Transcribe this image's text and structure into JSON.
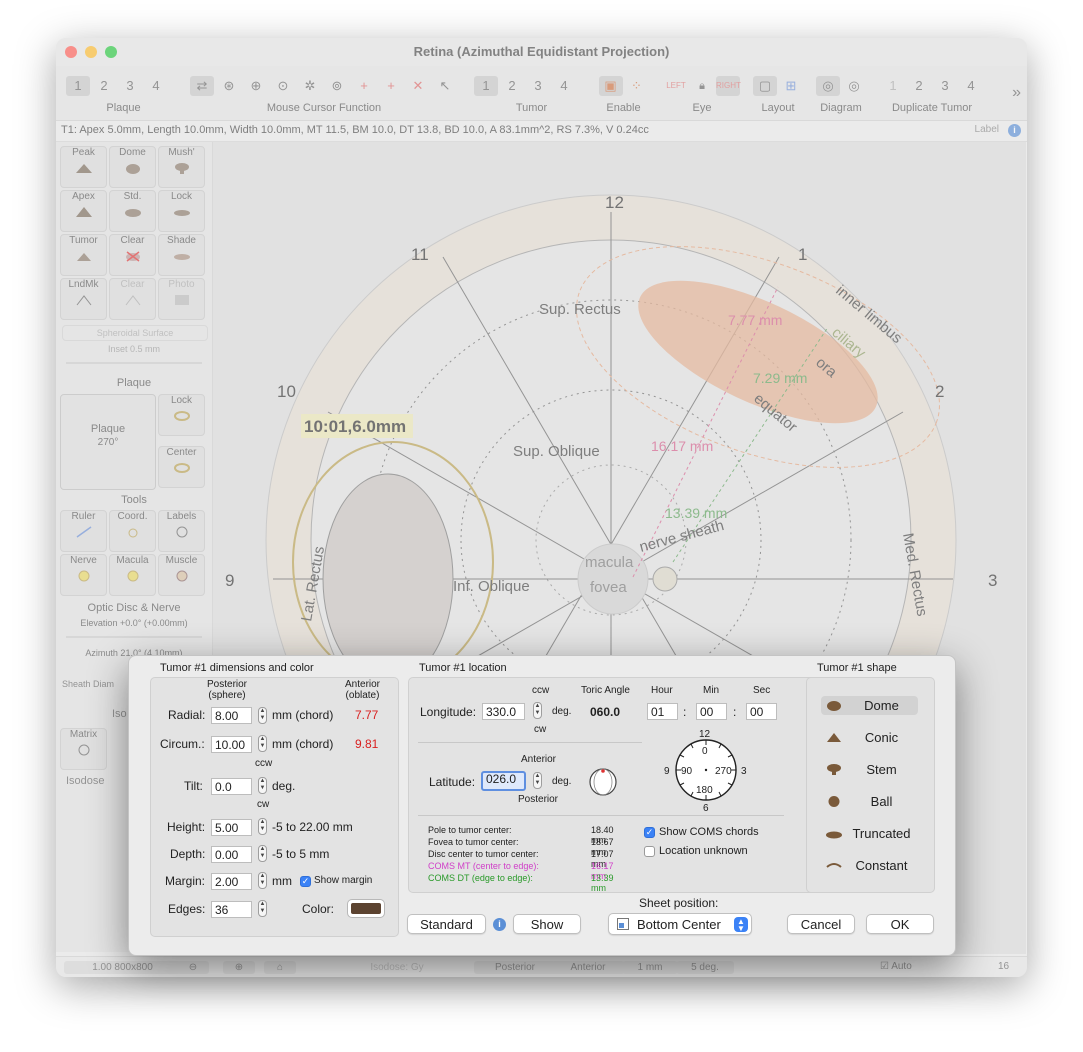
{
  "window": {
    "title": "Retina (Azimuthal Equidistant Projection)",
    "info_text": "T1: Apex 5.0mm, Length 10.0mm, Width 10.0mm, MT 11.5, BM 10.0, DT 13.8, BD 10.0, A 83.1mm^2, RS 7.3%, V 0.24cc",
    "label_toggle": "Label"
  },
  "toolbar": {
    "plaque": {
      "label": "Plaque",
      "buttons": [
        "1",
        "2",
        "3",
        "4"
      ]
    },
    "mouse": {
      "label": "Mouse Cursor Function"
    },
    "tumor": {
      "label": "Tumor",
      "buttons": [
        "1",
        "2",
        "3",
        "4"
      ]
    },
    "enable": {
      "label": "Enable"
    },
    "eye": {
      "label": "Eye",
      "left": "LEFT",
      "right": "RIGHT"
    },
    "layout": {
      "label": "Layout"
    },
    "diagram": {
      "label": "Diagram"
    },
    "duplicate": {
      "label": "Duplicate Tumor",
      "buttons": [
        "1",
        "2",
        "3",
        "4"
      ]
    },
    "more": "»"
  },
  "sidebar": {
    "tiles": [
      "Peak",
      "Dome",
      "Mush'",
      "Apex",
      "Std.",
      "Lock",
      "Tumor",
      "Clear",
      "Shade",
      "LndMk",
      "Clear",
      "Photo",
      "Lock",
      "Center",
      "Ruler",
      "Coord.",
      "Labels",
      "Nerve",
      "Macula",
      "Muscle",
      "Matrix"
    ],
    "spheroidal": "Spheroidal Surface",
    "inset": "Inset 0.5 mm",
    "plaque_heading": "Plaque",
    "plaque_text": "Plaque",
    "plaque_angle": "270°",
    "tools_heading": "Tools",
    "optic_heading": "Optic Disc & Nerve",
    "elevation": "Elevation +0.0° (+0.00mm)",
    "azimuth": "Azimuth 21.0° (4.10mm)",
    "sheath": "Sheath Diam",
    "iso": "Iso",
    "isodose": "Isodose"
  },
  "diagram": {
    "clock": [
      "12",
      "1",
      "2",
      "3",
      "9",
      "10",
      "11"
    ],
    "labels": {
      "sup_rectus": "Sup. Rectus",
      "sup_oblique": "Sup. Oblique",
      "inf_oblique": "Inf. Oblique",
      "lat_rectus": "Lat. Rectus",
      "med_rectus": "Med. Rectus",
      "inner_limbus": "inner limbus",
      "ciliary": "ciliary",
      "ora": "ora",
      "equator": "equator",
      "macula": "macula",
      "fovea": "fovea",
      "nerve_sheath": "nerve sheath"
    },
    "measurements": [
      "7.77 mm",
      "7.29 mm",
      "16.17 mm",
      "13.39 mm"
    ],
    "cursor_readout": "10:01,6.0mm",
    "colors": {
      "tumor": "#e2a07a",
      "coms_mt": "#d45c8a",
      "coms_dt": "#5aa05a",
      "plaque": "#b8a050"
    }
  },
  "statusbar": {
    "scale": "1.00 800x800",
    "isodose": "Isodose: Gy",
    "posterior": "Posterior",
    "anterior": "Anterior",
    "mm": "1 mm",
    "deg": "5 deg.",
    "auto": "Auto",
    "page": "16"
  },
  "sheet": {
    "dims": {
      "title": "Tumor #1 dimensions and color",
      "col_post": "Posterior\n(sphere)",
      "col_ant": "Anterior\n(oblate)",
      "radial_label": "Radial:",
      "radial_value": "8.00",
      "radial_unit": "mm (chord)",
      "radial_ant": "7.77",
      "circum_label": "Circum.:",
      "circum_value": "10.00",
      "circum_unit": "mm (chord)",
      "circum_ant": "9.81",
      "ccw": "ccw",
      "tilt_label": "Tilt:",
      "tilt_value": "0.0",
      "tilt_unit": "deg.",
      "cw": "cw",
      "height_label": "Height:",
      "height_value": "5.00",
      "height_range": "-5 to 22.00 mm",
      "depth_label": "Depth:",
      "depth_value": "0.00",
      "depth_range": "-5 to 5 mm",
      "margin_label": "Margin:",
      "margin_value": "2.00",
      "margin_unit": "mm",
      "show_margin": "Show margin",
      "edges_label": "Edges:",
      "edges_value": "36",
      "color_label": "Color:",
      "color_value": "#5c4330"
    },
    "location": {
      "title": "Tumor #1 location",
      "ccw": "ccw",
      "cw": "cw",
      "toric_header": "Toric Angle",
      "longitude_label": "Longitude:",
      "longitude_value": "330.0",
      "deg": "deg.",
      "toric_value": "060.0",
      "hour_h": "Hour",
      "min_h": "Min",
      "sec_h": "Sec",
      "hour": "01",
      "min": "00",
      "sec": "00",
      "colon": ":",
      "anterior": "Anterior",
      "posterior": "Posterior",
      "latitude_label": "Latitude:",
      "latitude_value": "026.0",
      "dial": {
        "n12": "12",
        "n0": "0",
        "n9": "9",
        "n90": "90",
        "n270": "270",
        "n3": "3",
        "n180": "180",
        "n6": "6"
      },
      "pole": "Pole to tumor center:",
      "pole_v": "18.40 mm",
      "fovea": "Fovea to tumor center:",
      "fovea_v": "18.67 mm",
      "disc": "Disc center to tumor center:",
      "disc_v": "17.07 mm",
      "coms_mt": "COMS MT (center to edge):",
      "coms_mt_v": "16.17 mm",
      "coms_dt": "COMS DT (edge to edge):",
      "coms_dt_v": "13.39 mm",
      "show_coms": "Show COMS chords",
      "location_unknown": "Location unknown"
    },
    "shape": {
      "title": "Tumor #1 shape",
      "options": [
        "Dome",
        "Conic",
        "Stem",
        "Ball",
        "Truncated",
        "Constant"
      ]
    },
    "bottom": {
      "standard": "Standard",
      "show": "Show",
      "sheet_position_label": "Sheet position:",
      "sheet_position_value": "Bottom Center",
      "cancel": "Cancel",
      "ok": "OK"
    }
  }
}
